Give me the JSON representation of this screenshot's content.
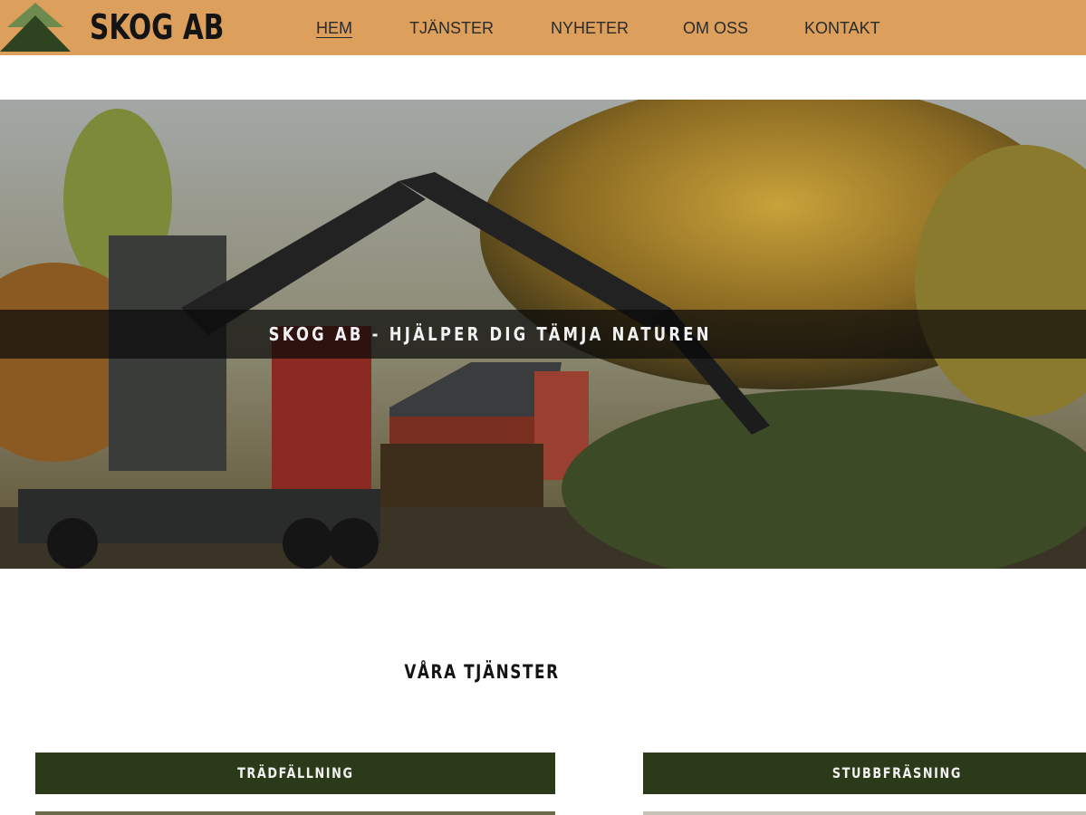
{
  "header": {
    "brand": "SKOG AB",
    "logo_icon": "pine-tree-logo",
    "nav": [
      {
        "label": "HEM",
        "active": true
      },
      {
        "label": "TJÄNSTER",
        "active": false
      },
      {
        "label": "NYHETER",
        "active": false
      },
      {
        "label": "OM OSS",
        "active": false
      },
      {
        "label": "KONTAKT",
        "active": false
      }
    ]
  },
  "hero": {
    "title": "SKOG AB - HJÄLPER DIG TÄMJA NATUREN",
    "image": "forestry-crane-truck-photo"
  },
  "services": {
    "title": "VÅRA TJÄNSTER",
    "cards": [
      {
        "label": "TRÄDFÄLLNING"
      },
      {
        "label": "STUBBFRÄSNING"
      }
    ]
  },
  "colors": {
    "header_bg": "#dd9f5c",
    "card_bar": "#2b3a18",
    "logo_dark": "#2e4320",
    "logo_light": "#6f8a4e"
  }
}
